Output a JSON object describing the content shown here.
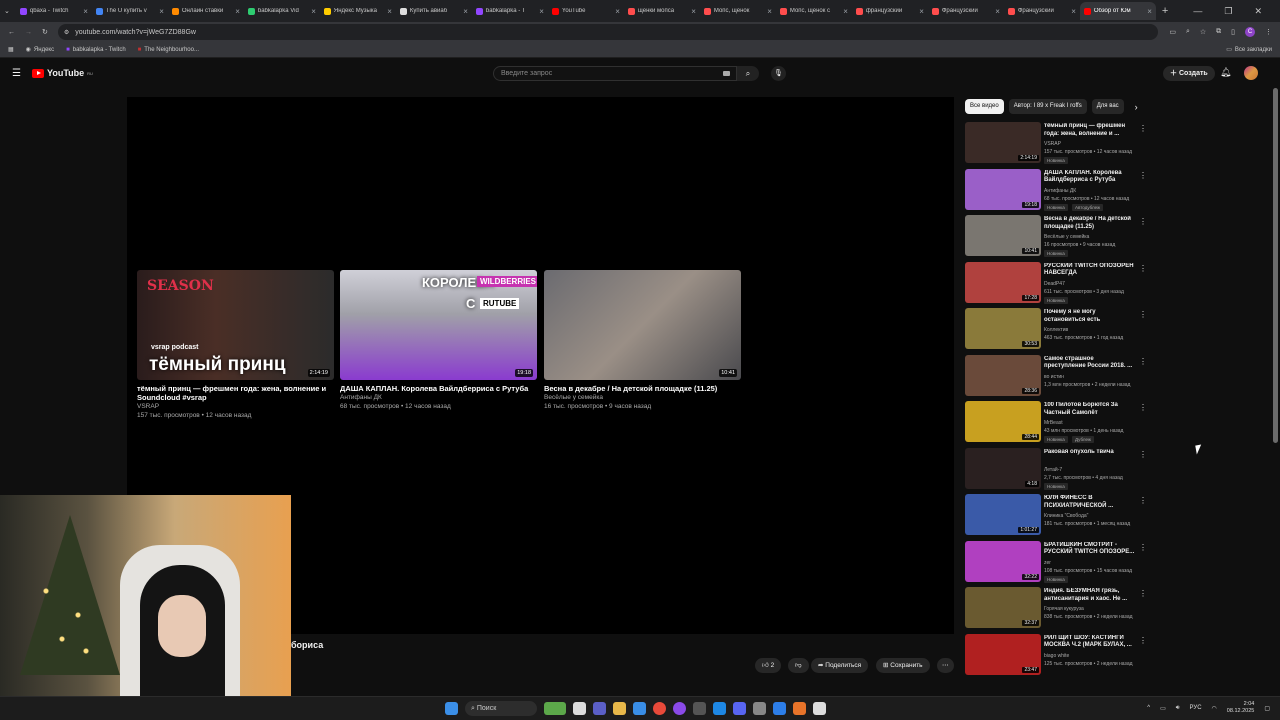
{
  "browser": {
    "tabs": [
      {
        "title": "qbaxa - Twitch",
        "color": "#9146ff"
      },
      {
        "title": "The U купить v",
        "color": "#4285f4"
      },
      {
        "title": "Онлайн ставки",
        "color": "#ff8a00"
      },
      {
        "title": "babkalapka Vid",
        "color": "#2ecc71"
      },
      {
        "title": "Яндекс Музыка",
        "color": "#ffcc00"
      },
      {
        "title": "Купить авиаб",
        "color": "#dddddd"
      },
      {
        "title": "babkalapka - T",
        "color": "#9146ff"
      },
      {
        "title": "YouTube",
        "color": "#ff0000"
      },
      {
        "title": "щенки мопса",
        "color": "#ff4d4d"
      },
      {
        "title": "Мопс, щенок",
        "color": "#ff4d4d"
      },
      {
        "title": "Мопс, щенок с",
        "color": "#ff4d4d"
      },
      {
        "title": "французский",
        "color": "#ff4d4d"
      },
      {
        "title": "Французский",
        "color": "#ff4d4d"
      },
      {
        "title": "Французский",
        "color": "#ff4d4d"
      },
      {
        "title": "Обзор от Юм",
        "color": "#ff0000"
      }
    ],
    "url": "youtube.com/watch?v=jWeG7ZD88Gw",
    "bookmarks": {
      "apps": "Яндекс",
      "b1": "babkalapka - Twitch",
      "b2": "The Neighbourhoo...",
      "all": "Все закладки"
    },
    "profile_letter": "C"
  },
  "youtube": {
    "logo_text": "YouTube",
    "logo_region": "RU",
    "search_placeholder": "Введите запрос",
    "create_label": "Создать",
    "chips": [
      "Все видео",
      "Автор: I 89 x Freak I roffs",
      "Для вас"
    ],
    "endcards": [
      {
        "title": "тёмный принц — фрешмен года: жена, волнение и Soundcloud #vsrap",
        "channel": "VSRAP",
        "meta": "157 тыс. просмотров • 12 часов назад",
        "duration": "2:14:19",
        "caption": "тёмный принц",
        "small": "vsrap podcast"
      },
      {
        "title": "ДАША КАПЛАН. Королева Вайлдберриса с Рутуба",
        "channel": "Антифаны ДК",
        "meta": "68 тыс. просмотров • 12 часов назад",
        "duration": "19:18",
        "caption": "КОРОЛЕВА",
        "badge_wb": "WILDBERRIES",
        "badge_rt": "RUTUBE",
        "prefix": "С"
      },
      {
        "title": "Весна в декабре / На детской площадке (11.25)",
        "channel": "Весёлые у семейка",
        "meta": "16 тыс. просмотров • 9 часов назад",
        "duration": "10:41"
      }
    ],
    "video_title_fragment": "бориса",
    "actions": {
      "likes": "2",
      "share": "Поделиться",
      "save": "Сохранить"
    },
    "sidebar": [
      {
        "title": "тёмный принц — фрешмен года: жена, волнение и ...",
        "channel": "VSRAP",
        "views": "157 тыс. просмотров • 12 часов назад",
        "badge": "Новинка",
        "duration": "2:14:19",
        "thumb": "#3a2a26"
      },
      {
        "title": "ДАША КАПЛАН. Королева Вайлдберриса с Рутуба",
        "channel": "Антифаны ДК",
        "views": "68 тыс. просмотров • 12 часов назад",
        "badge": "Новинка",
        "badge2": "Автодублеж",
        "duration": "19:18",
        "thumb": "#9a5fc8"
      },
      {
        "title": "Весна в декабре / На детской площадке (11.25)",
        "channel": "Весёлые у семейка",
        "views": "16 просмотров • 9 часов назад",
        "badge": "Новинка",
        "duration": "10:41",
        "thumb": "#7a7670"
      },
      {
        "title": "РУССКИЙ TWITCH ОПОЗОРЕН НАВСЕГДА",
        "channel": "DeadP47",
        "views": "611 тыс. просмотров • 3 дня назад",
        "badge": "Новинка",
        "duration": "17:28",
        "thumb": "#b0413e"
      },
      {
        "title": "Почему я не могу остановиться есть",
        "channel": "Коллектив",
        "views": "463 тыс. просмотров • 1 год назад",
        "duration": "30:53",
        "thumb": "#8a7a3a"
      },
      {
        "title": "Самое страшное преступление России 2018. ...",
        "channel": "во истин",
        "views": "1,3 млн просмотров • 2 недели назад",
        "duration": "28:36",
        "thumb": "#6a4a3a"
      },
      {
        "title": "100 Пилотов Борются За Частный Самолёт",
        "channel": "MrBeast",
        "views": "43 млн просмотров • 1 день назад",
        "badge": "Новинка",
        "badge2": "Дублеж",
        "duration": "28:44",
        "thumb": "#c8a020"
      },
      {
        "title": "Раковая опухоль твича",
        "channel": "Летай-7",
        "views": "2,7 тыс. просмотров • 4 дня назад",
        "badge": "Новинка",
        "duration": "4:18",
        "thumb": "#2a2020"
      },
      {
        "title": "ЮЛЯ ФИНЕСС В ПСИХИАТРИЧЕСКОЙ ...",
        "channel": "Клиника \"Свобода\"",
        "views": "181 тыс. просмотров • 1 месяц назад",
        "duration": "1:01:27",
        "thumb": "#3a5aa8"
      },
      {
        "title": "БРАТИШКИН СМОТРИТ - РУССКИЙ TWITCH ОПОЗОРЕ...",
        "channel": "zer",
        "views": "108 тыс. просмотров • 15 часов назад",
        "badge": "Новинка",
        "duration": "32:22",
        "thumb": "#b040c0"
      },
      {
        "title": "Индия. БЕЗУМНАЯ грязь, антисанитария и хаос. Не ...",
        "channel": "Горячая кукуруза",
        "views": "838 тыс. просмотров • 2 недели назад",
        "duration": "32:37",
        "thumb": "#6a5a30"
      },
      {
        "title": "РИЛ ЩИТ ШОУ: КАСТИНГИ МОСКВА Ч.2 (МАРК БУЛАХ, ...",
        "channel": "biago white",
        "views": "125 тыс. просмотров • 2 недели назад",
        "duration": "23:47",
        "thumb": "#b02020"
      }
    ]
  },
  "taskbar": {
    "search": "Поиск",
    "lang": "РУС",
    "time": "2:04",
    "date": "08.12.2025"
  }
}
